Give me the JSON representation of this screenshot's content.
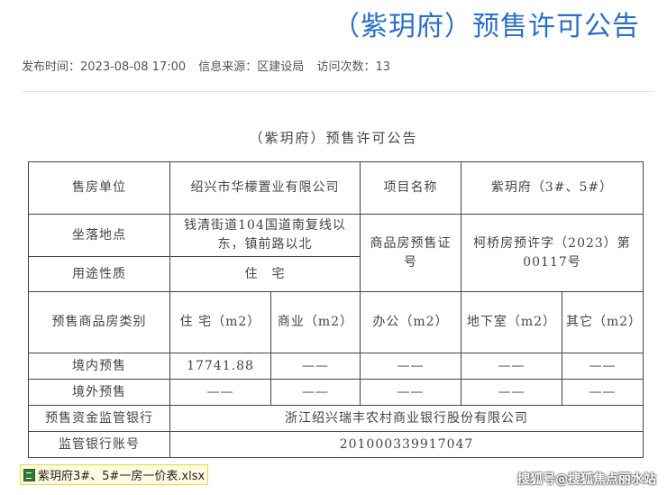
{
  "page": {
    "title": "（紫玥府）预售许可公告",
    "meta": {
      "published": "发布时间：2023-08-08 17:00",
      "source": "信息来源：区建设局",
      "visits": "访问次数：13"
    },
    "doc_heading": "（紫玥府）预售许可公告"
  },
  "table": {
    "seller_label": "售房单位",
    "seller_value": "绍兴市华檬置业有限公司",
    "project_label": "项目名称",
    "project_value": "紫玥府（3#、5#）",
    "location_label": "坐落地点",
    "location_value": "钱清街道104国道南复线以东，镇前路以北",
    "cert_label": "商品房预售证号",
    "cert_value": "柯桥房预许字（2023）第00117号",
    "usage_label": "用途性质",
    "usage_value": "住　宅",
    "category_label": "预售商品房类别",
    "category_headers": [
      "住 宅（m2）",
      "商业（m2）",
      "办公（m2）",
      "地下室（m2）",
      "其它（m2）"
    ],
    "domestic_label": "境内预售",
    "domestic_values": [
      "17741.88",
      "——",
      "——",
      "——",
      "——"
    ],
    "foreign_label": "境外预售",
    "foreign_values": [
      "——",
      "——",
      "——",
      "——",
      "——"
    ],
    "bank_label": "预售资金监管银行",
    "bank_value": "浙江绍兴瑞丰农村商业银行股份有限公司",
    "account_label": "监管银行账号",
    "account_value": "201000339917047"
  },
  "attachment": {
    "icon": "excel-file-icon",
    "name": "紫玥府3#、5#一房一价表.xlsx"
  },
  "watermark": "搜狐号@搜狐焦点丽水站"
}
